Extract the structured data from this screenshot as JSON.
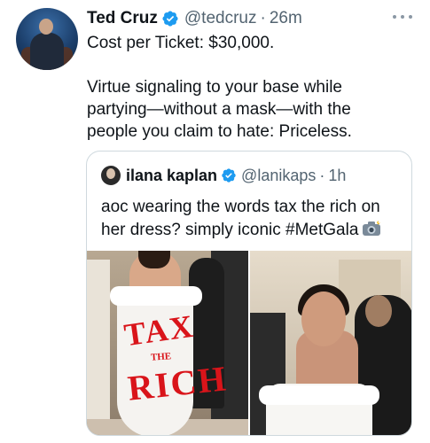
{
  "tweet": {
    "author_name": "Ted Cruz",
    "author_handle": "@tedcruz",
    "separator": "·",
    "time": "26m",
    "lines": [
      "Cost per Ticket: $30,000.",
      "Virtue signaling to your base while",
      "partying—without a mask—with the",
      "people you claim to hate: Priceless."
    ]
  },
  "quoted_tweet": {
    "author_name": "ilana kaplan",
    "author_handle": "@lanikaps",
    "separator": "·",
    "time": "1h",
    "lines": [
      "aoc wearing the words tax the rich on",
      "her dress? simply iconic #MetGala"
    ],
    "dress_text": [
      "TAX",
      "THE",
      "RICH"
    ]
  },
  "icons": {
    "verified": "verified-badge-icon",
    "more": "more-options-icon",
    "camera": "camera-flash-icon"
  },
  "colors": {
    "verified_blue": "#1d9bf0",
    "secondary_text": "#536471",
    "border": "#cfd9de"
  }
}
